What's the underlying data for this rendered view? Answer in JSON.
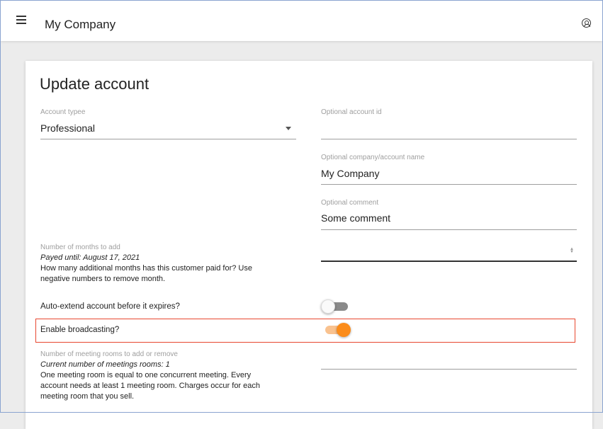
{
  "header": {
    "menu_icon": "hamburger-menu-icon",
    "app_title": "My Company",
    "account_icon": "account-circle-icon"
  },
  "form": {
    "title": "Update account",
    "account_type": {
      "label": "Account typee",
      "value": "Professional",
      "icon": "dropdown-arrow-icon"
    },
    "account_id": {
      "label": "Optional account id",
      "value": ""
    },
    "company_name": {
      "label": "Optional company/account name",
      "value": "My Company"
    },
    "comment": {
      "label": "Optional comment",
      "value": "Some comment"
    },
    "months": {
      "label": "Number of months to add",
      "payed_until": "Payed until: August 17, 2021",
      "help": "How many additional months has this customer paid for? Use negative numbers to remove month.",
      "value": ""
    },
    "auto_extend": {
      "label": "Auto-extend account before it expires?",
      "enabled": false
    },
    "broadcasting": {
      "label": "Enable broadcasting?",
      "enabled": true,
      "accent": "#fb8c1a",
      "highlight_color": "#e8472f"
    },
    "meeting_rooms": {
      "label": "Number of meeting rooms to add or remove",
      "current": "Current number of meetings rooms: 1",
      "help": "One meeting room is equal to one concurrent meeting. Every account needs at least 1 meeting room. Charges occur for each meeting room that you sell.",
      "value": ""
    }
  }
}
